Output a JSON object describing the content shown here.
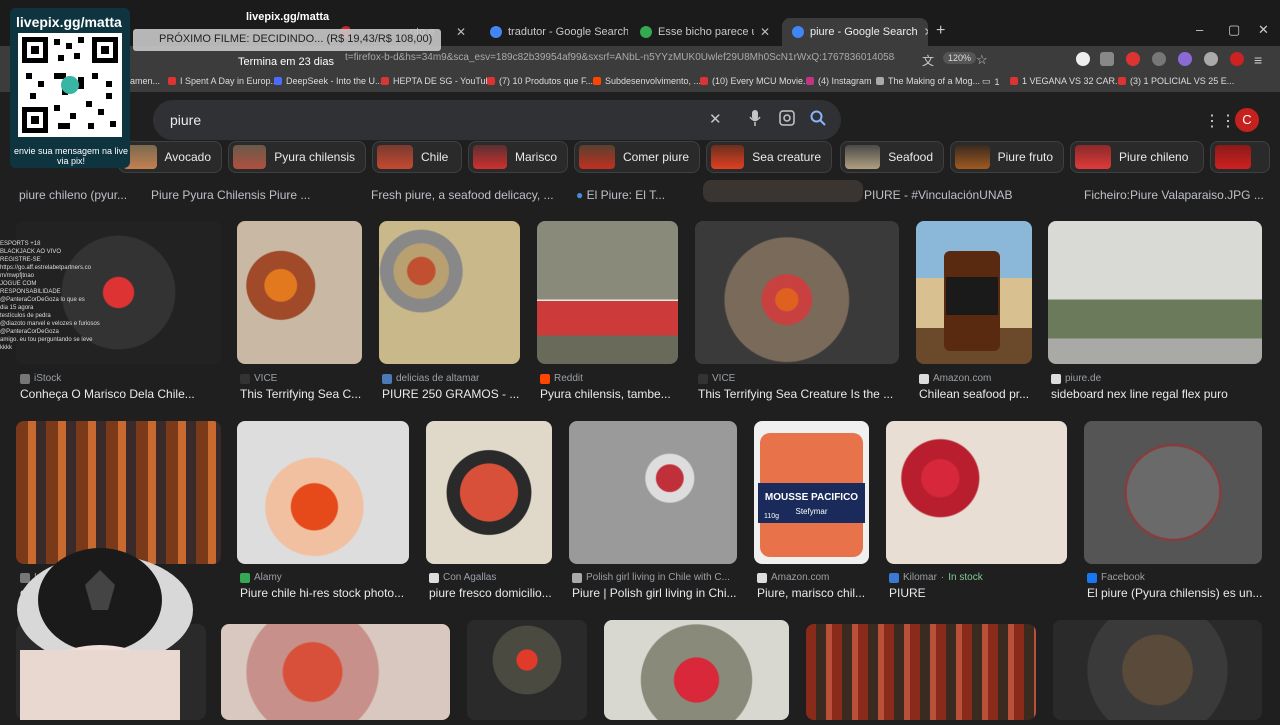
{
  "tabs": [
    {
      "label": "",
      "color": "#c6242b"
    },
    {
      "label": "nto e",
      "color": "#c6242b"
    },
    {
      "label": "tradutor - Google Search",
      "color": "#4285f4"
    },
    {
      "label": "Esse bicho parece uma pedra c",
      "color": "#34a853"
    },
    {
      "label": "piure - Google Search",
      "color": "#4285f4"
    }
  ],
  "window_controls": [
    "–",
    "▢",
    "✕"
  ],
  "url_text": "www.google.com/search?q=piure&sca_esv=189c82b39954af99&sxsrf=ANbL-n5YYzMUK0Uwlef29U8Mh0ScN1rWxQ:1767836014058&udm=2&fbs",
  "url_partial": "t=firefox-b-d&hs=34m9&sca_esv=189c82b39954af99&sxsrf=ANbL-n5YYzMUK0Uwlef29U8Mh0ScN1rWxQ:1767836014058&udm=2&fbs",
  "zoom": "120%",
  "bookmarks": [
    "amen...",
    "I Spent A Day in Europ...",
    "DeepSeek - Into the U...",
    "HEPTA DE SG - YouTube",
    "(7) 10 Produtos que F...",
    "Subdesenvolvimento, ...",
    "(10) Every MCU Movie...",
    "(4) Instagram",
    "The Making of a Mog...",
    "1",
    "1 VEGANA VS 32 CAR...",
    "(3) 1 POLICIAL VS 25 E..."
  ],
  "search": {
    "query": "piure"
  },
  "avatar_letter": "C",
  "chips": [
    "Avocado",
    "Pyura chilensis",
    "Chile",
    "Marisco",
    "Comer piure",
    "Sea creature",
    "Seafood",
    "Piure fruto",
    "Piure chileno"
  ],
  "top_captions": [
    "piure chileno (pyur...",
    "Piure Pyura Chilensis Piure ...",
    "Fresh piure, a seafood delicacy, ...",
    "El Piure: El T...",
    "PIURE - #VinculaciónUNAB",
    "Ficheiro:Piure Valaparaiso.JPG ..."
  ],
  "row1": [
    {
      "source": "iStock",
      "title": "Conheça O Marisco Dela Chile..."
    },
    {
      "source": "VICE",
      "title": "This Terrifying Sea C..."
    },
    {
      "source": "delicias de altamar",
      "title": "PIURE 250 GRAMOS - ..."
    },
    {
      "source": "Reddit",
      "title": "Pyura chilensis, tambe..."
    },
    {
      "source": "VICE",
      "title": "This Terrifying Sea Creature Is the ..."
    },
    {
      "source": "Amazon.com",
      "title": "Chilean seafood pr..."
    },
    {
      "source": "piure.de",
      "title": "sideboard nex line regal flex puro"
    }
  ],
  "row2": [
    {
      "source": "In",
      "title": "d..."
    },
    {
      "source": "Alamy",
      "title": "Piure chile hi-res stock photo..."
    },
    {
      "source": "Con Agallas",
      "title": "piure fresco domicilio..."
    },
    {
      "source": "Polish girl living in Chile with C...",
      "title": "Piure | Polish girl living in Chi..."
    },
    {
      "source": "Amazon.com",
      "title": "Piure, marisco chil..."
    },
    {
      "source": "Kilomar",
      "stock": "In stock",
      "title": "PIURE"
    },
    {
      "source": "Facebook",
      "title": "El piure (Pyura chilensis) es un..."
    }
  ],
  "product_labels": {
    "jar_brand": "MOUSSE PACIFICO",
    "jar_sub": "Stefymar",
    "jar_weight": "110g"
  },
  "stream": {
    "qr_title": "livepix.gg/matta",
    "qr_caption": "envie sua mensagem na live via pix!",
    "overlay_title": "livepix.gg/matta",
    "film_banner": "PRÓXIMO FILME: DECIDINDO... (R$ 19,43/R$ 108,00)",
    "days": "Termina em 23 dias",
    "chat_lines": [
      "ESPORTS +18",
      "BLACKJACK AO VIVO",
      "REGISTRE-SE",
      "https://go.aff.estrelabetpartners.co",
      "m/mwpfjtnao",
      "JOGUE COM",
      "RESPONSABILIDADE",
      "@PanteraCorDeGoza lo que es",
      "dia 15 agora",
      "testículos de pedra",
      "@diazoto marvel e velozes e furiosos",
      "@PanteraCorDeGoza",
      "amigo. eu tou perguntando se leve",
      "kkkk"
    ]
  },
  "colors": {
    "accent": "#8ab4f8",
    "bg": "#1f1f1f",
    "chip_border": "#3c4043"
  }
}
